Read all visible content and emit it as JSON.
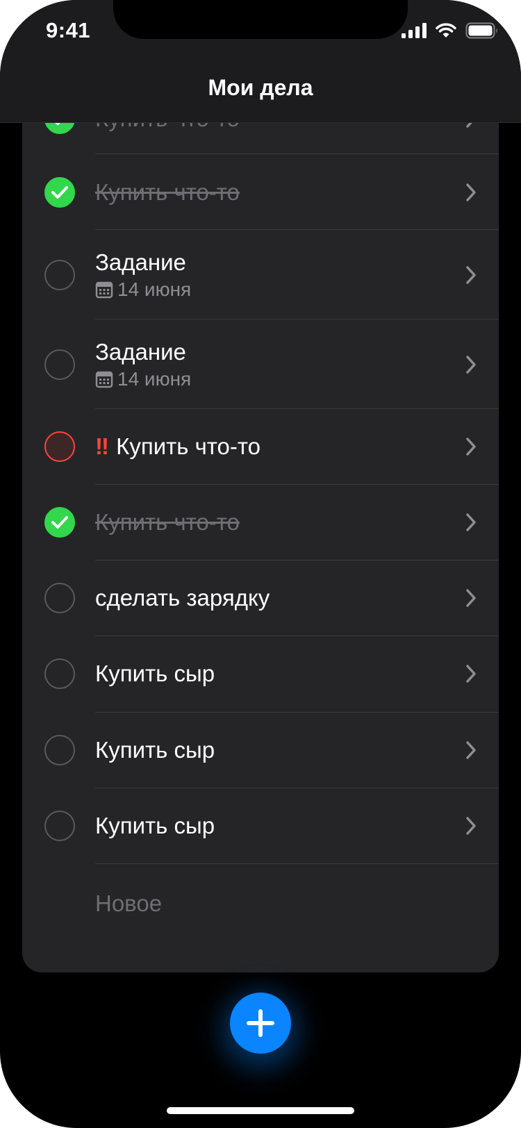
{
  "status_bar": {
    "time": "9:41"
  },
  "nav": {
    "title": "Мои дела"
  },
  "tasks": [
    {
      "title": "Купить что-то",
      "status": "done"
    },
    {
      "title": "Купить что-то",
      "status": "done"
    },
    {
      "title": "Задание",
      "status": "open",
      "date": "14 июня"
    },
    {
      "title": "Задание",
      "status": "open",
      "date": "14 июня"
    },
    {
      "title": "Купить что-то",
      "status": "urgent",
      "priority_mark": "‼"
    },
    {
      "title": "Купить что-то",
      "status": "done"
    },
    {
      "title": "сделать зарядку",
      "status": "open"
    },
    {
      "title": "Купить сыр",
      "status": "open"
    },
    {
      "title": "Купить сыр",
      "status": "open"
    },
    {
      "title": "Купить сыр",
      "status": "open"
    }
  ],
  "new_task": {
    "placeholder": "Новое"
  },
  "colors": {
    "background": "#000000",
    "card": "#252528",
    "accent": "#0a84ff",
    "done": "#32d74b",
    "urgent": "#ff453a",
    "secondary_text": "#8e8e93"
  },
  "icons": {
    "add_button": "plus-icon",
    "row_disclosure": "chevron-right-icon",
    "date": "calendar-icon",
    "completed": "checkmark-icon"
  }
}
